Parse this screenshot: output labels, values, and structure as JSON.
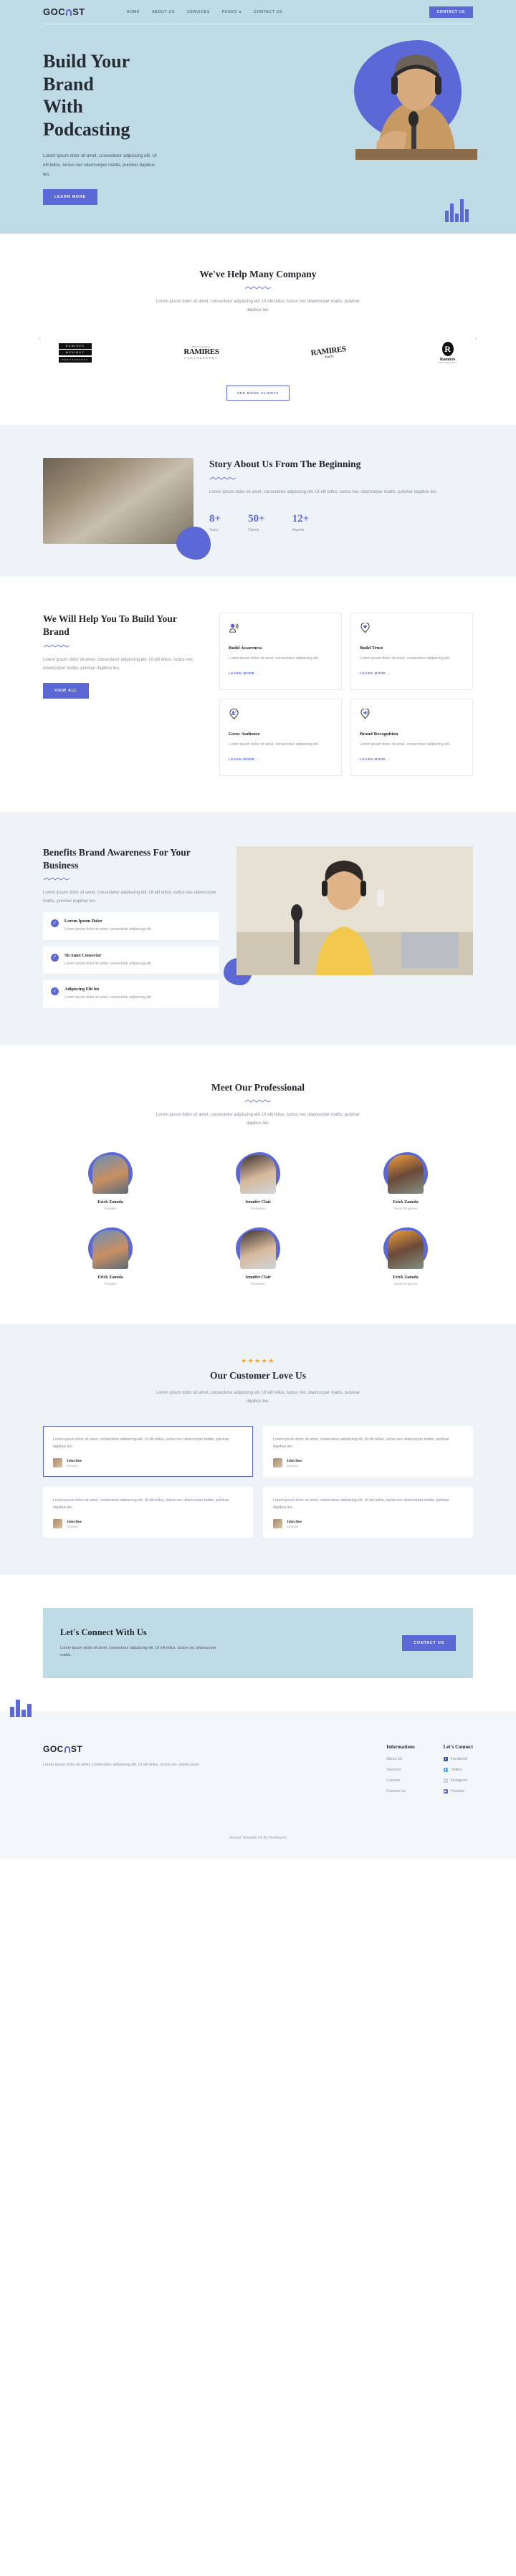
{
  "brand": {
    "name": "GOCAST",
    "accent": "#5b68d6",
    "hero_bg": "#bedbe6"
  },
  "nav": {
    "links": [
      {
        "label": "HOME",
        "caret": false
      },
      {
        "label": "ABOUT US",
        "caret": false
      },
      {
        "label": "SERVICES",
        "caret": false
      },
      {
        "label": "PAGES",
        "caret": true
      },
      {
        "label": "CONTACT US",
        "caret": false
      }
    ],
    "cta": "CONTACT US"
  },
  "hero": {
    "title_lines": [
      "Build Your",
      "Brand",
      "With",
      "Podcasting"
    ],
    "paragraph": "Lorem ipsum dolor sit amet, consectetur adipiscing elit. Ut elit tellus, luctus nec ullamcorper mattis, pulvinar dapibus leo.",
    "button": "LEARN MORE"
  },
  "clients": {
    "title": "We've Help Many Company",
    "paragraph": "Lorem ipsum dolor sit amet, consectetur adipiscing elit. Ut elit tellus, luctus nec ullamcorper mattis, pulvinar dapibus leo.",
    "logos": [
      {
        "type": "stacked",
        "l1": "RAMIRES",
        "l2": "MCKINCY",
        "l3": "PHOTOGRAPHY"
      },
      {
        "type": "arch",
        "top": "PROFESSIONAL",
        "big": "RAMIRES",
        "sub": "PHOTOGRAPHY"
      },
      {
        "type": "slanted",
        "big": "RAMIRES",
        "script": "Studio"
      },
      {
        "type": "circle",
        "mark": "R",
        "big": "Ramires",
        "sub": "PHOTOGRAPHY"
      }
    ],
    "button": "SEE MORE CLIENTS"
  },
  "story": {
    "title": "Story About Us From The Beginning",
    "paragraph": "Lorem ipsum dolor sit amet, consectetur adipiscing elit. Ut elit tellus, luctus nec ullamcorper mattis, pulvinar dapibus leo.",
    "stats": [
      {
        "value": "8+",
        "label": "Years"
      },
      {
        "value": "50+",
        "label": "Clients"
      },
      {
        "value": "12+",
        "label": "Awards"
      }
    ]
  },
  "help": {
    "title": "We Will Help You To Build Your Brand",
    "paragraph": "Lorem ipsum dolor sit amet, consectetur adipiscing elit. Ut elit tellus, luctus nec ullamcorper mattis, pulvinar dapibus leo.",
    "button": "VIEW ALL",
    "cards": [
      {
        "icon": "speaking-person-icon",
        "title": "Build Awareness",
        "text": "Lorem ipsum dolor sit amet, consectetur adipiscing elit.",
        "link": "LEARN MORE"
      },
      {
        "icon": "heart-pin-icon",
        "title": "Build Trust",
        "text": "Lorem ipsum dolor sit amet, consectetur adipiscing elit.",
        "link": "LEARN MORE"
      },
      {
        "icon": "add-user-pin-icon",
        "title": "Grow Audience",
        "text": "Lorem ipsum dolor sit amet, consectetur adipiscing elit.",
        "link": "LEARN MORE"
      },
      {
        "icon": "megaphone-icon",
        "title": "Brand Recognition",
        "text": "Lorem ipsum dolor sit amet, consectetur adipiscing elit.",
        "link": "LEARN MORE"
      }
    ]
  },
  "benefits": {
    "title": "Benefits Brand Awareness For Your Business",
    "paragraph": "Lorem ipsum dolor sit amet, consectetur adipiscing elit. Ut elit tellus, luctus nec ullamcorper mattis, pulvinar dapibus leo.",
    "items": [
      {
        "title": "Lorem Ipsum Dolor",
        "text": "Lorem ipsum dolor sit amet, consectetur adipiscing elit."
      },
      {
        "title": "Sit Amet Consectur",
        "text": "Lorem ipsum dolor sit amet, consectetur adipiscing elit."
      },
      {
        "title": "Adipiscing Elit leo",
        "text": "Lorem ipsum dolor sit amet, consectetur adipiscing elit."
      }
    ]
  },
  "team": {
    "title": "Meet Our Professional",
    "paragraph": "Lorem ipsum dolor sit amet, consectetur adipiscing elit. Ut elit tellus, luctus nec ullamcorper mattis, pulvinar dapibus leo.",
    "members": [
      {
        "name": "Erick Zamola",
        "role": "Founder"
      },
      {
        "name": "Jennifer Clair",
        "role": "Podcaster"
      },
      {
        "name": "Erick Zamola",
        "role": "Sound Engineer"
      },
      {
        "name": "Erick Zamola",
        "role": "Founder"
      },
      {
        "name": "Jennifer Clair",
        "role": "Podcaster"
      },
      {
        "name": "Erick Zamola",
        "role": "Sound Engineer"
      }
    ]
  },
  "testimonials": {
    "stars": "★★★★★",
    "title": "Our Customer Love Us",
    "paragraph": "Lorem ipsum dolor sit amet, consectetur adipiscing elit. Ut elit tellus, luctus nec ullamcorper mattis, pulvinar dapibus leo.",
    "cards": [
      {
        "text": "Lorem ipsum dolor sit amet, consectetur adipiscing elit. Ut elit tellus, luctus nec ullamcorper mattis, pulvinar dapibus leo.",
        "name": "John Doe",
        "role": "Designer",
        "active": true
      },
      {
        "text": "Lorem ipsum dolor sit amet, consectetur adipiscing elit. Ut elit tellus, luctus nec ullamcorper mattis, pulvinar dapibus leo.",
        "name": "John Doe",
        "role": "Designer",
        "active": false
      },
      {
        "text": "Lorem ipsum dolor sit amet, consectetur adipiscing elit. Ut elit tellus, luctus nec ullamcorper mattis, pulvinar dapibus leo.",
        "name": "John Doe",
        "role": "Designer",
        "active": false
      },
      {
        "text": "Lorem ipsum dolor sit amet, consectetur adipiscing elit. Ut elit tellus, luctus nec ullamcorper mattis, pulvinar dapibus leo.",
        "name": "John Doe",
        "role": "Designer",
        "active": false
      }
    ]
  },
  "cta": {
    "title": "Let's Connect With Us",
    "paragraph": "Lorem ipsum dolor sit amet, consectetur adipiscing elit. Ut elit tellus, luctus nec ullamcorper mattis.",
    "button": "CONTACT US"
  },
  "footer": {
    "logo": "GOCAST",
    "about": "Lorem ipsum dolor sit amet, consectetur adipiscing elit. Ut elit tellus, luctus nec ullamcorper.",
    "info_title": "Informations",
    "info_links": [
      "About Us",
      "Services",
      "Careers",
      "Contact Us"
    ],
    "connect_title": "Let's Connect",
    "social": [
      {
        "label": "Facebook",
        "glyph": "f",
        "color": "#3b5998"
      },
      {
        "label": "Twitter",
        "glyph": "t",
        "color": "#55acee"
      },
      {
        "label": "Instagram",
        "glyph": "◎",
        "color": "#c9cfda"
      },
      {
        "label": "Youtube",
        "glyph": "▶",
        "color": "#5b68d6"
      }
    ],
    "copyright": "Gocast Template Kit By Rootlayers"
  }
}
